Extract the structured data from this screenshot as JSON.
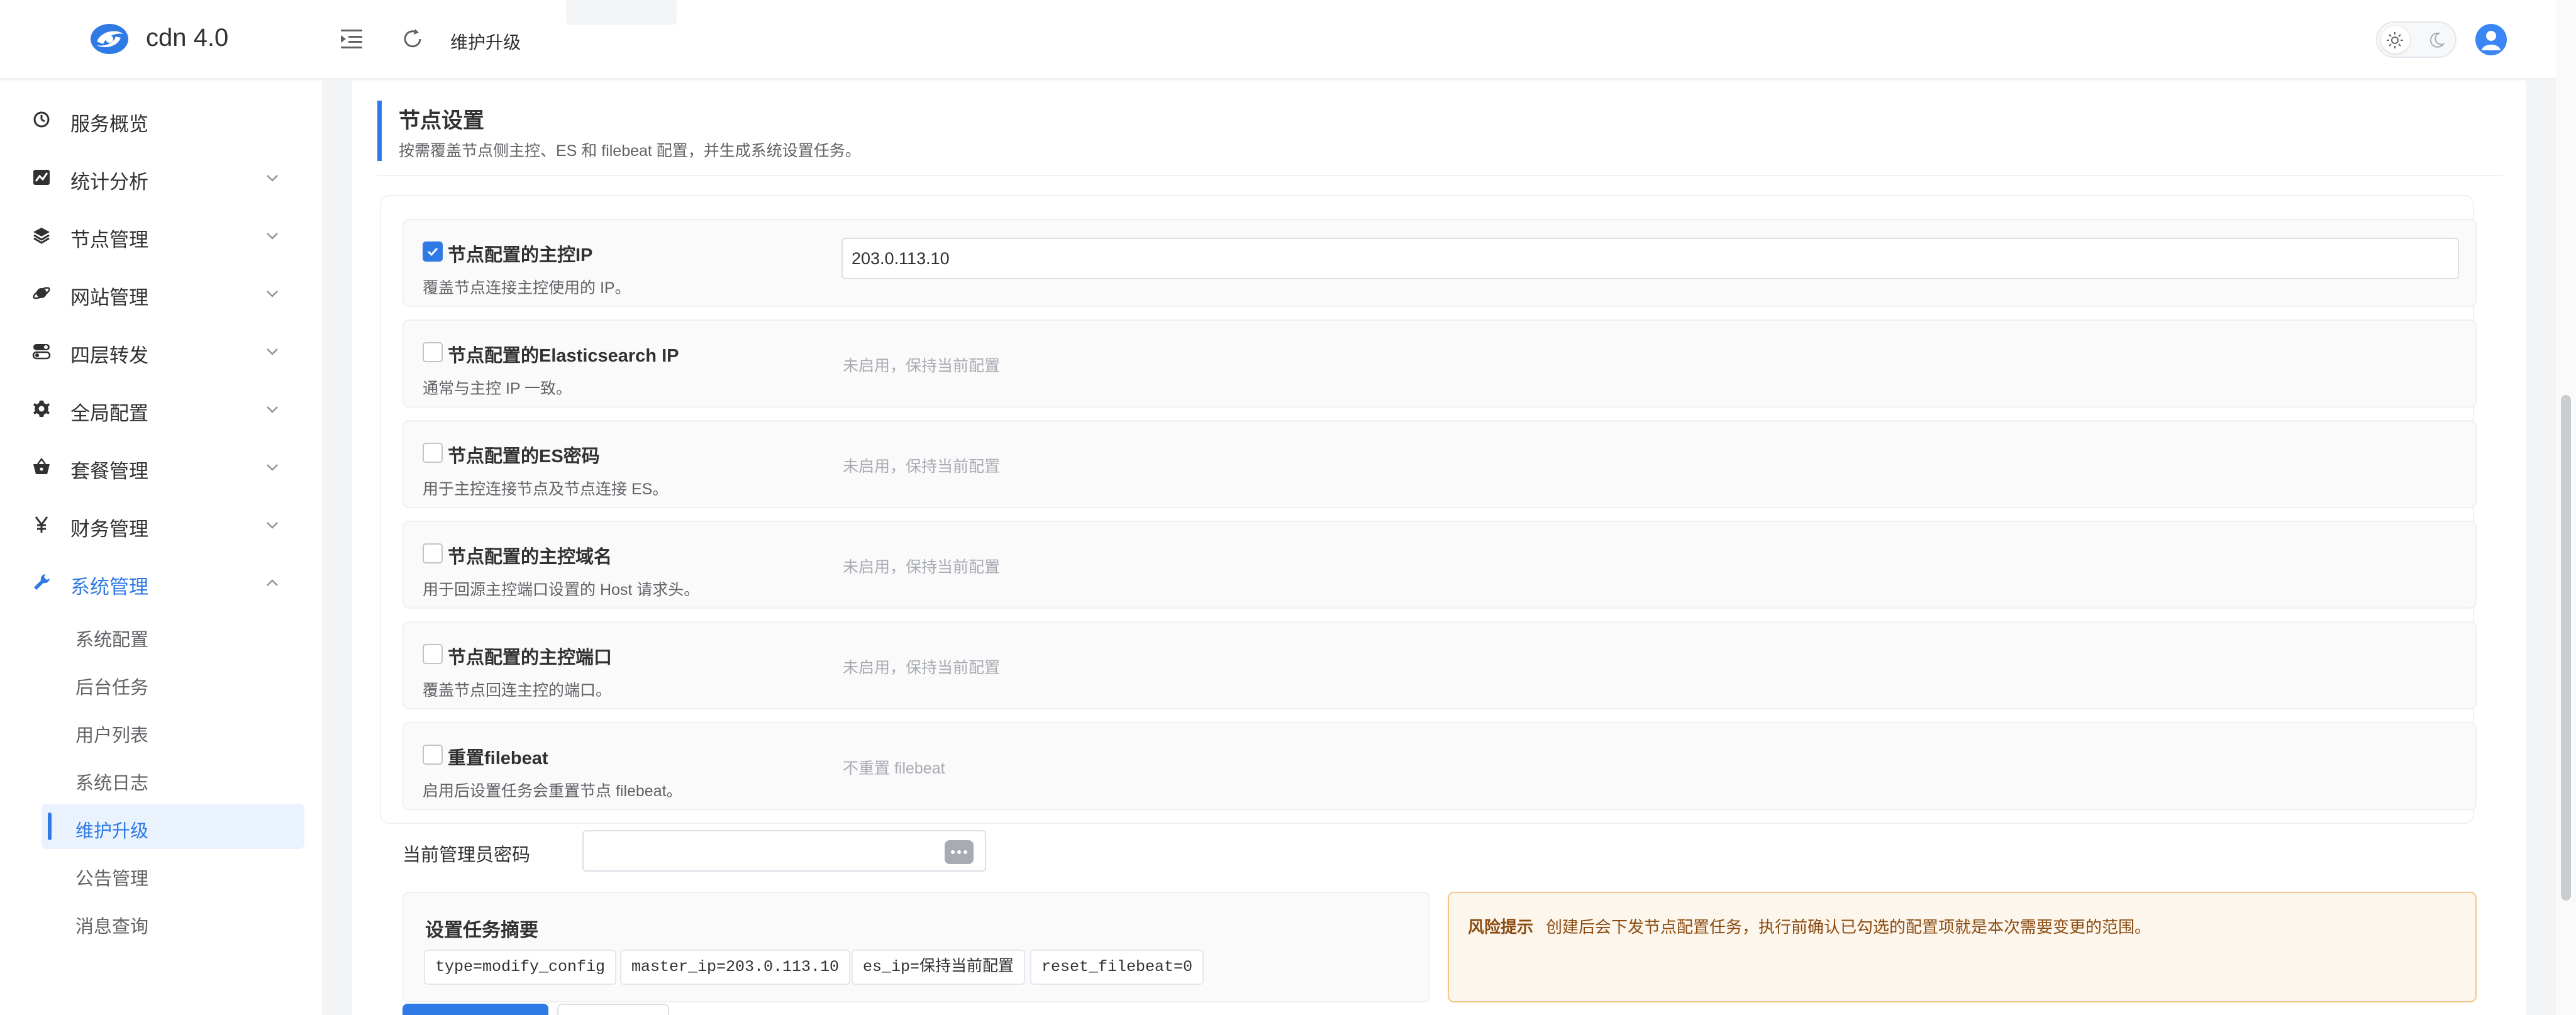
{
  "app": {
    "title": "cdn 4.0",
    "logo_icon": "cdn-logo-icon",
    "breadcrumb": "维护升级",
    "accent_color": "#2f7ae5"
  },
  "sidebar": {
    "items": [
      {
        "label": "服务概览",
        "icon": "dashboard-icon",
        "expandable": false
      },
      {
        "label": "统计分析",
        "icon": "chart-icon",
        "expandable": true
      },
      {
        "label": "节点管理",
        "icon": "layers-icon",
        "expandable": true
      },
      {
        "label": "网站管理",
        "icon": "planet-icon",
        "expandable": true
      },
      {
        "label": "四层转发",
        "icon": "toggle-icon",
        "expandable": true
      },
      {
        "label": "全局配置",
        "icon": "gear-icon",
        "expandable": true
      },
      {
        "label": "套餐管理",
        "icon": "basket-icon",
        "expandable": true
      },
      {
        "label": "财务管理",
        "icon": "yen-icon",
        "expandable": true
      },
      {
        "label": "系统管理",
        "icon": "wrench-icon",
        "expandable": true,
        "expanded": true,
        "active": true
      }
    ],
    "sub_items": [
      {
        "label": "系统配置"
      },
      {
        "label": "后台任务"
      },
      {
        "label": "用户列表"
      },
      {
        "label": "系统日志"
      },
      {
        "label": "维护升级",
        "active": true
      },
      {
        "label": "公告管理"
      },
      {
        "label": "消息查询"
      }
    ]
  },
  "section": {
    "title": "节点设置",
    "description": "按需覆盖节点侧主控、ES 和 filebeat 配置，并生成系统设置任务。"
  },
  "options": [
    {
      "title": "节点配置的主控IP",
      "description": "覆盖节点连接主控使用的 IP。",
      "checked": true,
      "value": "203.0.113.10"
    },
    {
      "title": "节点配置的Elasticsearch IP",
      "description": "通常与主控 IP 一致。",
      "checked": false,
      "hint": "未启用，保持当前配置"
    },
    {
      "title": "节点配置的ES密码",
      "description": "用于主控连接节点及节点连接 ES。",
      "checked": false,
      "hint": "未启用，保持当前配置"
    },
    {
      "title": "节点配置的主控域名",
      "description": "用于回源主控端口设置的 Host 请求头。",
      "checked": false,
      "hint": "未启用，保持当前配置"
    },
    {
      "title": "节点配置的主控端口",
      "description": "覆盖节点回连主控的端口。",
      "checked": false,
      "hint": "未启用，保持当前配置"
    },
    {
      "title": "重置filebeat",
      "description": "启用后设置任务会重置节点 filebeat。",
      "checked": false,
      "hint": "不重置 filebeat"
    }
  ],
  "password": {
    "label": "当前管理员密码",
    "value": ""
  },
  "summary": {
    "title": "设置任务摘要",
    "tags": [
      "type=modify_config",
      "master_ip=203.0.113.10",
      "es_ip=保持当前配置",
      "reset_filebeat=0"
    ]
  },
  "risk": {
    "title": "风险提示",
    "text": "创建后会下发节点配置任务，执行前确认已勾选的配置项就是本次需要变更的范围。"
  }
}
